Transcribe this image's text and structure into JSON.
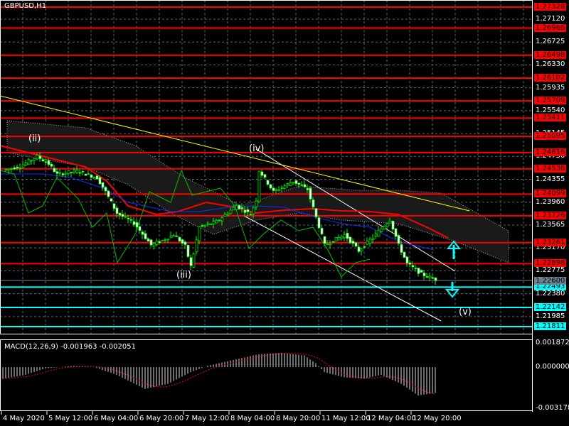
{
  "window": {
    "symbol_title": "GBPUSD,H1"
  },
  "indicator": {
    "macd_label": "MACD(12,26,9) -0.001963 -0.002051"
  },
  "colors": {
    "level_red": "#ff0000",
    "level_cyan": "#00ffff",
    "current": "#708090",
    "trend_yellow": "#ffff00",
    "ma_red": "#ff0000",
    "kijun_blue": "#0000ff",
    "chikou_green": "#00c000"
  },
  "chart_data": {
    "type": "candlestick",
    "title": "GBPUSD,H1",
    "price_axis_ticks": [
      "1.27120",
      "1.26725",
      "1.26330",
      "1.25935",
      "1.25540",
      "1.25145",
      "1.24750",
      "1.24355",
      "1.23960",
      "1.23565",
      "1.23170",
      "1.22775",
      "1.22380",
      "1.21985"
    ],
    "price_range": [
      1.2165,
      1.275
    ],
    "red_levels": [
      "1.27328",
      "1.26966",
      "1.26498",
      "1.26102",
      "1.25709",
      "1.25411",
      "1.25095",
      "1.24816",
      "1.24536",
      "1.24099",
      "1.23726",
      "1.23261",
      "1.22898"
    ],
    "cyan_levels": [
      "1.22493",
      "1.22142",
      "1.21811"
    ],
    "current_price": "1.22600",
    "time_labels": [
      "4 May 2020",
      "5 May 12:00",
      "6 May 04:00",
      "6 May 20:00",
      "7 May 12:00",
      "8 May 04:00",
      "8 May 20:00",
      "11 May 12:00",
      "12 May 04:00",
      "12 May 20:00"
    ],
    "close_keypoints": [
      [
        0,
        1.2451
      ],
      [
        6,
        1.2458
      ],
      [
        12,
        1.2475
      ],
      [
        16,
        1.2462
      ],
      [
        19,
        1.2444
      ],
      [
        26,
        1.245
      ],
      [
        33,
        1.2438
      ],
      [
        36,
        1.2414
      ],
      [
        40,
        1.2377
      ],
      [
        46,
        1.236
      ],
      [
        52,
        1.2322
      ],
      [
        56,
        1.233
      ],
      [
        60,
        1.234
      ],
      [
        64,
        1.232
      ],
      [
        66,
        1.2285
      ],
      [
        69,
        1.2353
      ],
      [
        75,
        1.2362
      ],
      [
        82,
        1.239
      ],
      [
        87,
        1.2375
      ],
      [
        89,
        1.24
      ],
      [
        90,
        1.2451
      ],
      [
        95,
        1.2414
      ],
      [
        102,
        1.2432
      ],
      [
        107,
        1.2418
      ],
      [
        110,
        1.237
      ],
      [
        113,
        1.2322
      ],
      [
        120,
        1.234
      ],
      [
        125,
        1.2312
      ],
      [
        131,
        1.234
      ],
      [
        136,
        1.2366
      ],
      [
        139,
        1.2322
      ],
      [
        142,
        1.229
      ],
      [
        147,
        1.2272
      ],
      [
        152,
        1.2262
      ]
    ],
    "wave_labels": [
      "(ii)",
      "(iii)",
      "(iv)",
      "(v)"
    ],
    "macd": {
      "axis_ticks": [
        "0.001872",
        "0.000000",
        "-0.003178"
      ],
      "range": [
        -0.003178,
        0.001872
      ],
      "histogram_keypoints": [
        [
          0,
          -0.0009
        ],
        [
          8,
          -0.0006
        ],
        [
          15,
          -0.0001
        ],
        [
          25,
          0.0001
        ],
        [
          32,
          0.0
        ],
        [
          40,
          -0.0006
        ],
        [
          50,
          -0.0017
        ],
        [
          58,
          -0.0013
        ],
        [
          66,
          -0.0004
        ],
        [
          72,
          0.0001
        ],
        [
          80,
          0.0005
        ],
        [
          90,
          0.001
        ],
        [
          98,
          0.0011
        ],
        [
          106,
          0.0009
        ],
        [
          110,
          0.0003
        ],
        [
          113,
          -0.0004
        ],
        [
          120,
          -0.0008
        ],
        [
          127,
          -0.0009
        ],
        [
          133,
          -0.0006
        ],
        [
          140,
          -0.0013
        ],
        [
          146,
          -0.0022
        ],
        [
          152,
          -0.002
        ]
      ]
    }
  }
}
